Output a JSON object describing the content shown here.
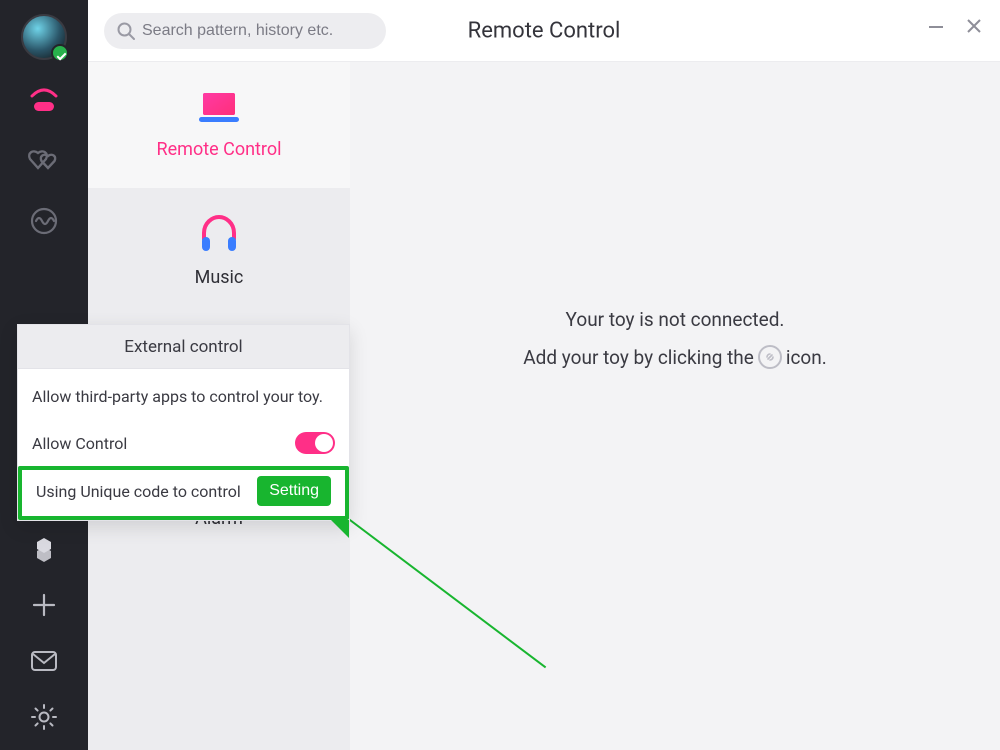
{
  "header": {
    "search_placeholder": "Search pattern, history etc.",
    "title": "Remote Control"
  },
  "features": {
    "remote": "Remote Control",
    "music": "Music",
    "alarm": "Alarm"
  },
  "main": {
    "line1": "Your toy is not connected.",
    "line2_a": "Add your toy by clicking the",
    "line2_b": "icon."
  },
  "popup": {
    "title": "External control",
    "desc": "Allow third-party apps to control your toy.",
    "allow_label": "Allow Control",
    "unique_label": "Using Unique code to control",
    "setting_btn": "Setting"
  }
}
